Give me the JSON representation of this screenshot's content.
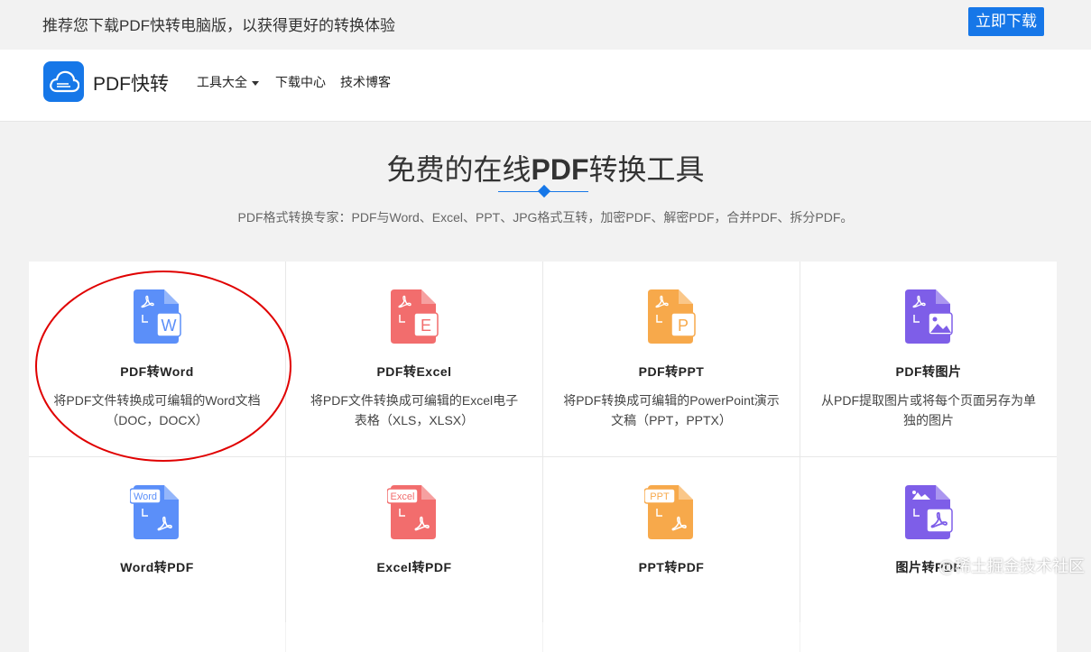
{
  "banner": {
    "text": "推荐您下载PDF快转电脑版，以获得更好的转换体验",
    "button": "立即下载"
  },
  "nav": {
    "brand": "PDF快转",
    "items": [
      "工具大全",
      "下载中心",
      "技术博客"
    ]
  },
  "hero": {
    "title_prefix": "免费的在线",
    "title_bold": "PDF",
    "title_suffix": "转换工具",
    "subtitle": "PDF格式转换专家：PDF与Word、Excel、PPT、JPG格式互转，加密PDF、解密PDF，合并PDF、拆分PDF。"
  },
  "tools": [
    {
      "title": "PDF转Word",
      "desc": "将PDF文件转换成可编辑的Word文档（DOC，DOCX）",
      "icon": "pdf-to-word-icon",
      "color": "#5b8ff9",
      "badge": "W"
    },
    {
      "title": "PDF转Excel",
      "desc": "将PDF文件转换成可编辑的Excel电子表格（XLS，XLSX）",
      "icon": "pdf-to-excel-icon",
      "color": "#f26d6d",
      "badge": "E"
    },
    {
      "title": "PDF转PPT",
      "desc": "将PDF转换成可编辑的PowerPoint演示文稿（PPT，PPTX）",
      "icon": "pdf-to-ppt-icon",
      "color": "#f7a94b",
      "badge": "P"
    },
    {
      "title": "PDF转图片",
      "desc": "从PDF提取图片或将每个页面另存为单独的图片",
      "icon": "pdf-to-image-icon",
      "color": "#7e5ee8",
      "badge": "img"
    },
    {
      "title": "Word转PDF",
      "desc": "",
      "icon": "word-to-pdf-icon",
      "color": "#5b8ff9",
      "badge": "Word"
    },
    {
      "title": "Excel转PDF",
      "desc": "",
      "icon": "excel-to-pdf-icon",
      "color": "#f26d6d",
      "badge": "Excel"
    },
    {
      "title": "PPT转PDF",
      "desc": "",
      "icon": "ppt-to-pdf-icon",
      "color": "#f7a94b",
      "badge": "PPT"
    },
    {
      "title": "图片转PDF",
      "desc": "",
      "icon": "image-to-pdf-icon",
      "color": "#7e5ee8",
      "badge": "img"
    }
  ],
  "watermark": "@稀土掘金技术社区",
  "accent": "#1677e8",
  "annotation_color": "#e00000"
}
